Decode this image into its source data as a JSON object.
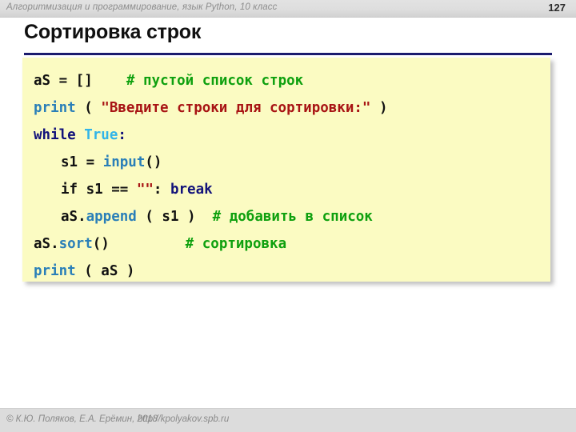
{
  "header": {
    "course": "Алгоритмизация и программирование, язык Python, 10 класс",
    "page_number": "127"
  },
  "title": "Сортировка строк",
  "colors": {
    "rule": "#1b1b6e",
    "code_background": "#fbfbc2",
    "header_background": "#dedede",
    "footer_background": "#dcdcdc",
    "builtin": "#2a7fb8",
    "keyword": "#12127a",
    "constant": "#31b4e8",
    "string": "#a81414",
    "comment": "#0ea00e",
    "plain": "#111111"
  },
  "code": {
    "language": "python",
    "lines": [
      {
        "indent": 0,
        "tokens": [
          {
            "text": "aS = []",
            "kind": "plain"
          },
          {
            "text": "    ",
            "kind": "plain"
          },
          {
            "text": "# пустой список строк",
            "kind": "comment"
          }
        ]
      },
      {
        "indent": 0,
        "tokens": [
          {
            "text": "print",
            "kind": "builtin"
          },
          {
            "text": " ( ",
            "kind": "plain"
          },
          {
            "text": "\"Введите строки для сортировки:\"",
            "kind": "string"
          },
          {
            "text": " )",
            "kind": "plain"
          }
        ]
      },
      {
        "indent": 0,
        "tokens": [
          {
            "text": "while",
            "kind": "keyword"
          },
          {
            "text": " ",
            "kind": "plain"
          },
          {
            "text": "True",
            "kind": "constant"
          },
          {
            "text": ":",
            "kind": "keyword"
          }
        ]
      },
      {
        "indent": 1,
        "tokens": [
          {
            "text": "s1 = ",
            "kind": "plain"
          },
          {
            "text": "input",
            "kind": "builtin"
          },
          {
            "text": "()",
            "kind": "plain"
          }
        ]
      },
      {
        "indent": 1,
        "tokens": [
          {
            "text": "if s1 == ",
            "kind": "plain"
          },
          {
            "text": "\"\"",
            "kind": "string"
          },
          {
            "text": ": ",
            "kind": "plain"
          },
          {
            "text": "break",
            "kind": "keyword"
          }
        ]
      },
      {
        "indent": 1,
        "tokens": [
          {
            "text": "aS.",
            "kind": "plain"
          },
          {
            "text": "append",
            "kind": "builtin"
          },
          {
            "text": " ( s1 )  ",
            "kind": "plain"
          },
          {
            "text": "# добавить в список",
            "kind": "comment"
          }
        ]
      },
      {
        "indent": 0,
        "tokens": [
          {
            "text": "aS.",
            "kind": "plain"
          },
          {
            "text": "sort",
            "kind": "builtin"
          },
          {
            "text": "()",
            "kind": "plain"
          },
          {
            "text": "         ",
            "kind": "plain"
          },
          {
            "text": "# сортировка",
            "kind": "comment"
          }
        ]
      },
      {
        "indent": 0,
        "tokens": [
          {
            "text": "print",
            "kind": "builtin"
          },
          {
            "text": " ( aS )",
            "kind": "plain"
          }
        ]
      }
    ]
  },
  "footer": {
    "copyright": "© К.Ю. Поляков, Е.А. Ерёмин, 2018",
    "url": "http://kpolyakov.spb.ru"
  }
}
